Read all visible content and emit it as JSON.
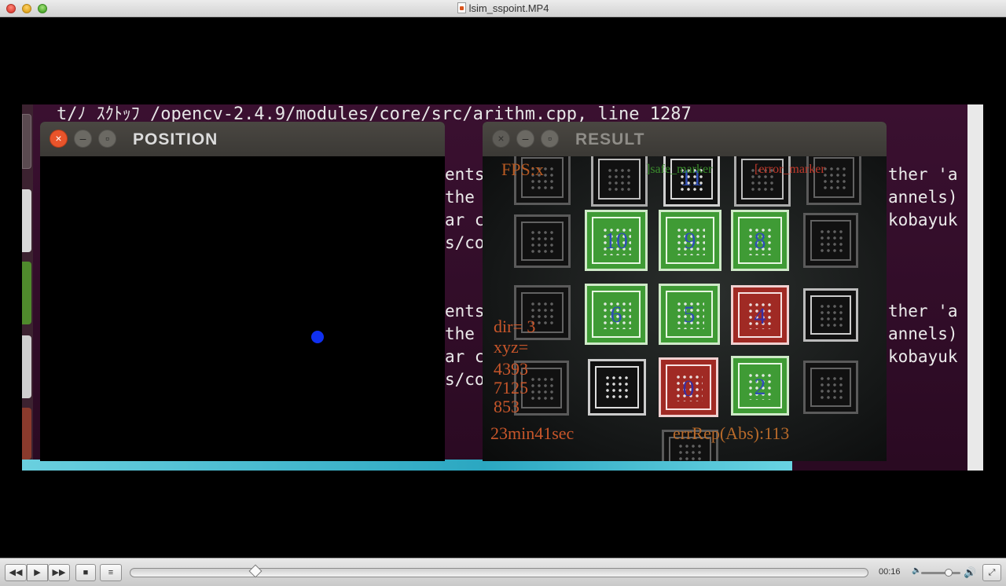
{
  "window": {
    "title": "lsim_sspoint.MP4"
  },
  "terminal": {
    "top_line": "t/ﾉ ｽｸﾄｯﾌ /opencv-2.4.9/modules/core/src/arithm.cpp, line 1287",
    "left_lines_a": [
      "ents",
      "the ",
      "ar c",
      "s/co"
    ],
    "left_lines_b": [
      "ents",
      "the ",
      "ar c",
      "s/co"
    ],
    "right_lines_a": [
      "ther 'a",
      "annels)",
      "kobayuk"
    ],
    "right_lines_b": [
      "ther 'a",
      "annels)",
      "kobayuk"
    ]
  },
  "position_window": {
    "title": "POSITION",
    "close_glyph": "×",
    "min_glyph": "–",
    "max_glyph": "▫"
  },
  "result_window": {
    "title": "RESULT",
    "close_glyph": "×",
    "min_glyph": "–",
    "max_glyph": "▫",
    "fps": "FPS:x",
    "legend_safe": "]safe_marker",
    "legend_error": "[error_marker",
    "dir": "dir= 3",
    "xyz_label": "xyz=",
    "x": "4393",
    "y": "7125",
    "z": "853",
    "elapsed": "23min41sec",
    "err": "errRep(Abs):113",
    "marker_numbers": [
      "11",
      "10",
      "9",
      "8",
      "6",
      "5",
      "4",
      "0",
      "2"
    ]
  },
  "controls": {
    "rewind": "◀◀",
    "play": "▶",
    "forward": "▶▶",
    "stop": "■",
    "menu": "≡",
    "time": "00:16",
    "progress": 0.165,
    "volume": 0.75,
    "vol_low_icon": "🔈",
    "vol_high_icon": "🔊",
    "fullscreen": "⤢"
  },
  "colors": {
    "safe": "#3f9b35",
    "error": "#a02a24",
    "overlay_text": "#c8562a",
    "position_dot": "#1030f0"
  }
}
